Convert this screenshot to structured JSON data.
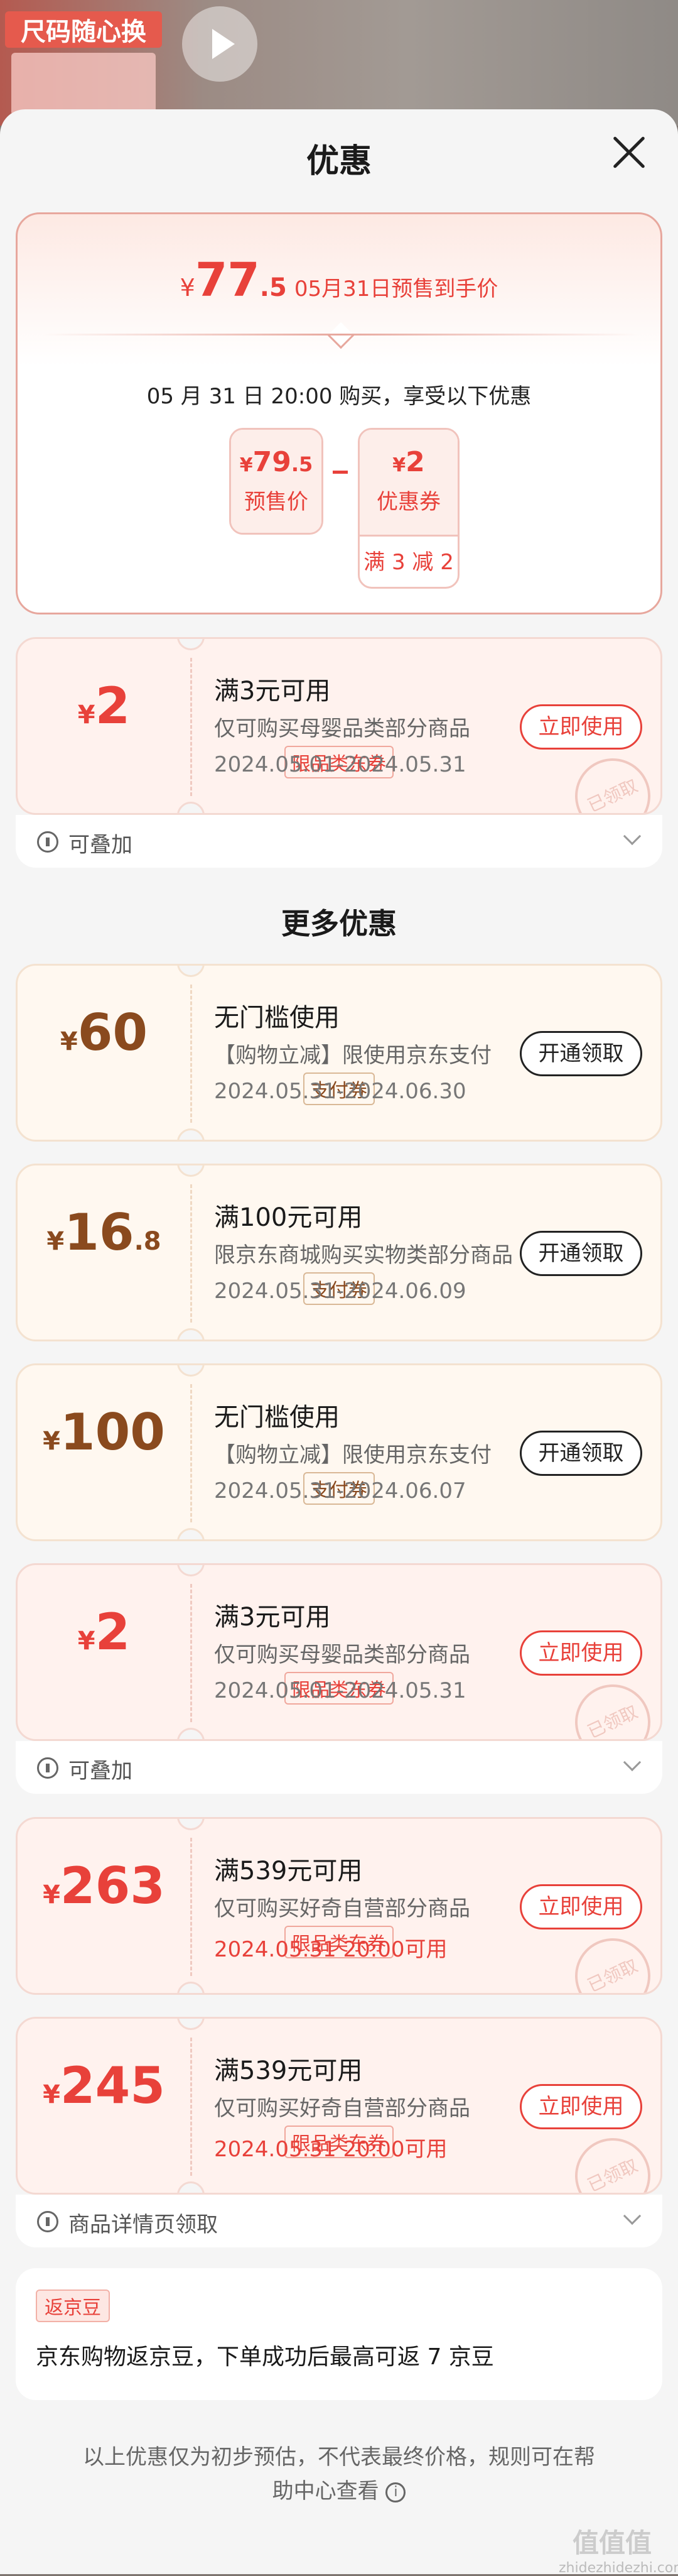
{
  "header": {
    "promo_tag": "尺码随心换",
    "title": "优惠",
    "close_icon": "close-icon"
  },
  "summary": {
    "currency": "¥",
    "final_int": "77",
    "final_dec": ".5",
    "final_desc": "05月31日预售到手价",
    "buy_time": "05 月 31 日 20:00 购买，享受以下优惠",
    "presale": {
      "currency": "¥",
      "int": "79",
      "dec": ".5",
      "label": "预售价"
    },
    "coupon": {
      "currency": "¥",
      "amount": "2",
      "label": "优惠券",
      "cond": "满 3 减 2"
    }
  },
  "coupons_top": [
    {
      "currency": "¥",
      "value": "2",
      "dec": "",
      "tag": "限品类东券",
      "title": "满3元可用",
      "desc": "仅可购买母婴品类部分商品",
      "date": "2024.05.01-2024.05.31",
      "button": "立即使用",
      "stamp": "已领取"
    }
  ],
  "stack_label": "可叠加",
  "more_title": "更多优惠",
  "coupons_more": [
    {
      "currency": "¥",
      "value": "60",
      "dec": "",
      "tag": "支付券",
      "title": "无门槛使用",
      "desc": "【购物立减】限使用京东支付",
      "date": "2024.05.31-2024.06.30",
      "button": "开通领取"
    },
    {
      "currency": "¥",
      "value": "16",
      "dec": ".8",
      "tag": "支付券",
      "title": "满100元可用",
      "desc": "限京东商城购买实物类部分商品",
      "date": "2024.05.31-2024.06.09",
      "button": "开通领取"
    },
    {
      "currency": "¥",
      "value": "100",
      "dec": "",
      "tag": "支付券",
      "title": "无门槛使用",
      "desc": "【购物立减】限使用京东支付",
      "date": "2024.05.31-2024.06.07",
      "button": "开通领取"
    },
    {
      "currency": "¥",
      "value": "2",
      "dec": "",
      "tag": "限品类东券",
      "title": "满3元可用",
      "desc": "仅可购买母婴品类部分商品",
      "date": "2024.05.01-2024.05.31",
      "button": "立即使用",
      "stamp": "已领取"
    },
    {
      "currency": "¥",
      "value": "263",
      "dec": "",
      "tag": "限品类东券",
      "title": "满539元可用",
      "desc": "仅可购买好奇自营部分商品",
      "date": "2024.05.31 20:00可用",
      "button": "立即使用",
      "stamp": "已领取"
    },
    {
      "currency": "¥",
      "value": "245",
      "dec": "",
      "tag": "限品类东券",
      "title": "满539元可用",
      "desc": "仅可购买好奇自营部分商品",
      "date": "2024.05.31 20:00可用",
      "button": "立即使用",
      "stamp": "已领取"
    }
  ],
  "detail_label": "商品详情页领取",
  "bean": {
    "tag": "返京豆",
    "text": "京东购物返京豆，下单成功后最高可返 7 京豆"
  },
  "disclaimer": "以上优惠仅为初步预估，不代表最终价格，规则可在帮助中心查看",
  "watermark": {
    "main": "值值值",
    "sub": "zhidezhidezhi.com"
  },
  "colors": {
    "accent": "#e8413a",
    "pay_brown": "#8a4a1e",
    "sheet_bg": "#f5f5f5"
  }
}
